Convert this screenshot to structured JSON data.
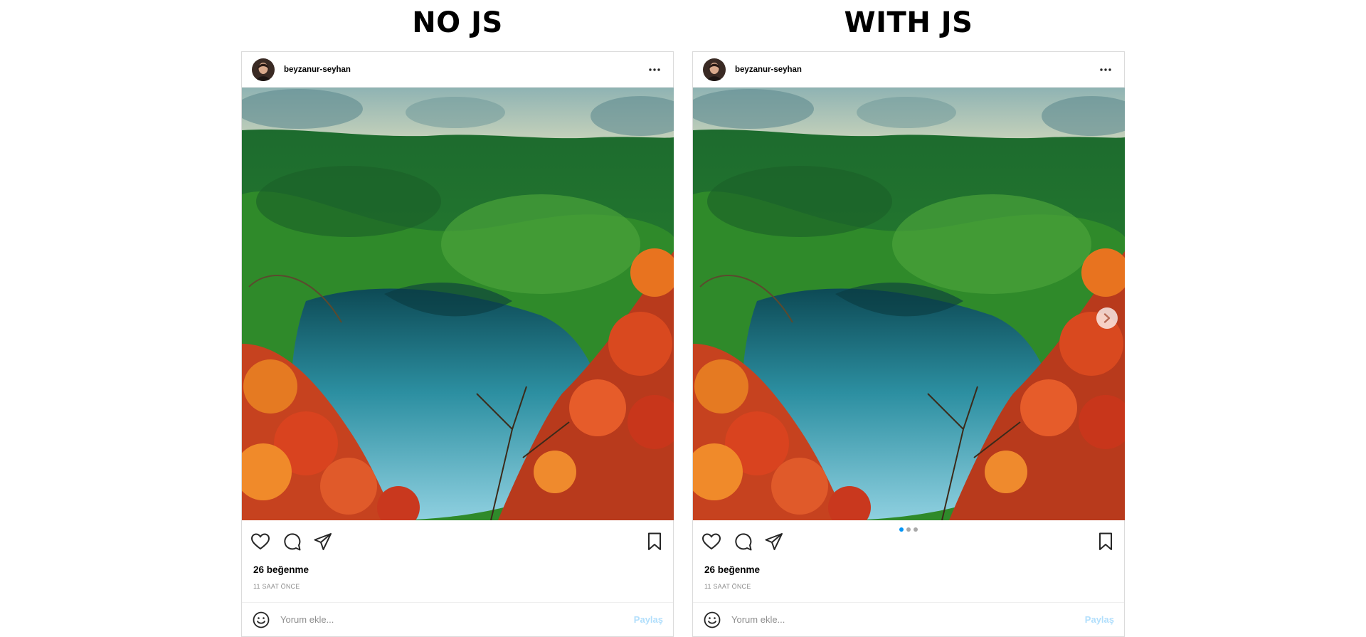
{
  "left": {
    "heading": "NO JS",
    "post": {
      "username": "beyzanur-seyhan",
      "likes": "26 beğenme",
      "time": "11 SAAT ÖNCE",
      "comment_placeholder": "Yorum ekle...",
      "post_button": "Paylaş"
    }
  },
  "right": {
    "heading": "WITH JS",
    "post": {
      "username": "beyzanur-seyhan",
      "likes": "26 beğenme",
      "time": "11 SAAT ÖNCE",
      "comment_placeholder": "Yorum ekle...",
      "post_button": "Paylaş",
      "carousel": {
        "count": 3,
        "active_index": 0
      }
    }
  },
  "icons": [
    "more-icon",
    "heart-icon",
    "comment-icon",
    "share-icon",
    "bookmark-icon",
    "emoji-icon",
    "chevron-right-icon"
  ],
  "colors": {
    "border": "#dbdbdb",
    "accent": "#0095f6",
    "post_button_disabled": "#b2dffc",
    "muted": "#8e8e8e"
  }
}
